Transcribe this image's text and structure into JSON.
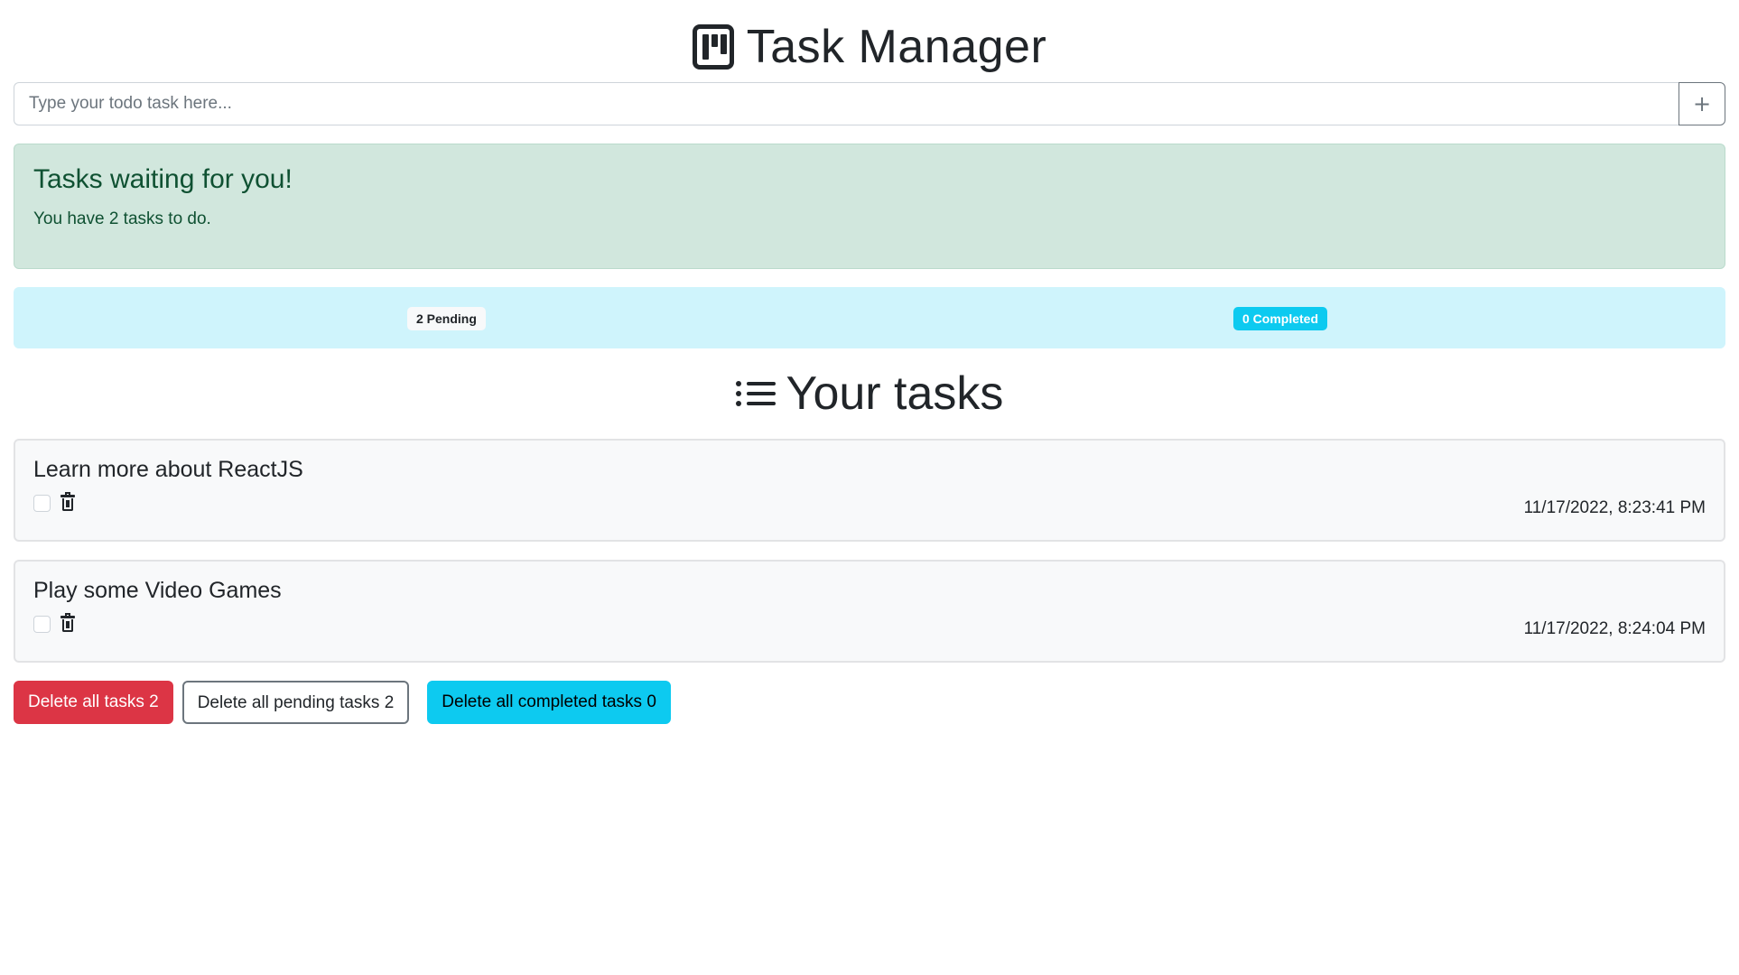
{
  "header": {
    "title": "Task Manager",
    "logo_icon": "kanban-icon"
  },
  "add_task": {
    "placeholder": "Type your todo task here...",
    "value": "",
    "button_label": "+"
  },
  "alert": {
    "heading": "Tasks waiting for you!",
    "text": "You have 2 tasks to do."
  },
  "status": {
    "pending_label": "2 Pending",
    "completed_label": "0 Completed"
  },
  "tasks_section": {
    "title": "Your tasks",
    "icon": "list-icon"
  },
  "tasks": [
    {
      "name": "Learn more about ReactJS",
      "timestamp": "11/17/2022, 8:23:41 PM",
      "completed": false
    },
    {
      "name": "Play some Video Games",
      "timestamp": "11/17/2022, 8:24:04 PM",
      "completed": false
    }
  ],
  "actions": {
    "delete_all": "Delete all tasks 2",
    "delete_pending": "Delete all pending tasks 2",
    "delete_completed": "Delete all completed tasks 0"
  },
  "colors": {
    "success_bg": "#d1e7dd",
    "info_bg": "#cff4fc",
    "danger": "#dc3545",
    "info": "#0dcaf0"
  }
}
